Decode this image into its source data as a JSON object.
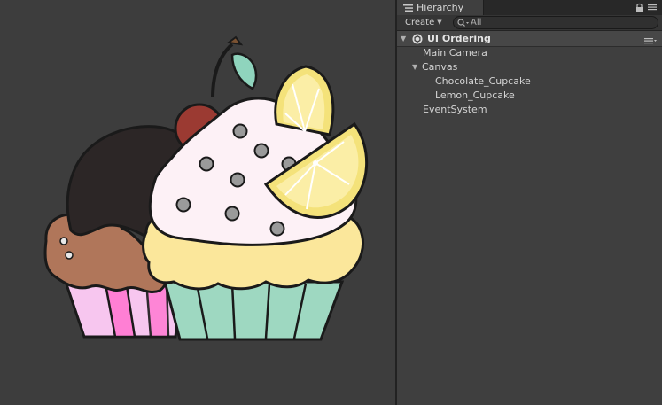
{
  "window": {
    "tab_label": "Hierarchy",
    "tab_icon": "list-icon"
  },
  "toolbar": {
    "create_label": "Create",
    "search_placeholder": "All"
  },
  "scene": {
    "name": "UI Ordering"
  },
  "tree": [
    {
      "label": "Main Camera",
      "depth": 0,
      "expandable": false
    },
    {
      "label": "Canvas",
      "depth": 0,
      "expandable": true,
      "expanded": true
    },
    {
      "label": "Chocolate_Cupcake",
      "depth": 1,
      "expandable": false
    },
    {
      "label": "Lemon_Cupcake",
      "depth": 1,
      "expandable": false
    },
    {
      "label": "EventSystem",
      "depth": 0,
      "expandable": false
    }
  ],
  "colors": {
    "panel_bg": "#3f3f3f",
    "scene_bg": "#3d3d3d",
    "text": "#d4d4d4"
  }
}
